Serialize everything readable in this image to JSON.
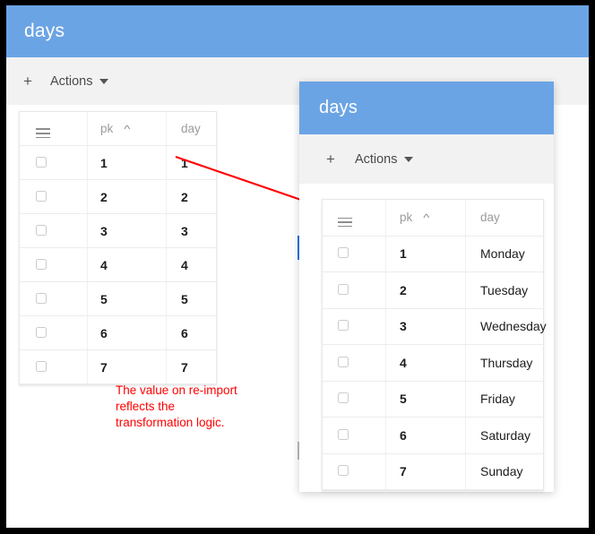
{
  "back_window": {
    "title": "days",
    "toolbar": {
      "add_label": "+",
      "actions_label": "Actions"
    },
    "grid": {
      "menu_icon": "hamburger-menu-icon",
      "columns": [
        "pk",
        "day"
      ],
      "sort_column": "pk",
      "sort_direction": "asc",
      "sort_caret": "^",
      "rows": [
        {
          "pk": "1",
          "day": "1"
        },
        {
          "pk": "2",
          "day": "2"
        },
        {
          "pk": "3",
          "day": "3"
        },
        {
          "pk": "4",
          "day": "4"
        },
        {
          "pk": "5",
          "day": "5"
        },
        {
          "pk": "6",
          "day": "6"
        },
        {
          "pk": "7",
          "day": "7"
        }
      ]
    }
  },
  "front_window": {
    "title": "days",
    "toolbar": {
      "add_label": "+",
      "actions_label": "Actions"
    },
    "grid": {
      "menu_icon": "hamburger-menu-icon",
      "columns": [
        "pk",
        "day"
      ],
      "sort_column": "pk",
      "sort_direction": "asc",
      "sort_caret": "^",
      "rows": [
        {
          "pk": "1",
          "day": "Monday"
        },
        {
          "pk": "2",
          "day": "Tuesday"
        },
        {
          "pk": "3",
          "day": "Wednesday"
        },
        {
          "pk": "4",
          "day": "Thursday"
        },
        {
          "pk": "5",
          "day": "Friday"
        },
        {
          "pk": "6",
          "day": "Saturday"
        },
        {
          "pk": "7",
          "day": "Sunday"
        }
      ]
    }
  },
  "annotation": {
    "text": "The value on re-import\nreflects the\ntransformation logic.",
    "color": "#ff0000"
  },
  "colors": {
    "header_blue": "#6ba4e5",
    "toolbar_gray": "#f2f2f2",
    "annotation_red": "#ff0000",
    "marker_blue": "#1a73e8",
    "frame_black": "#000000"
  }
}
